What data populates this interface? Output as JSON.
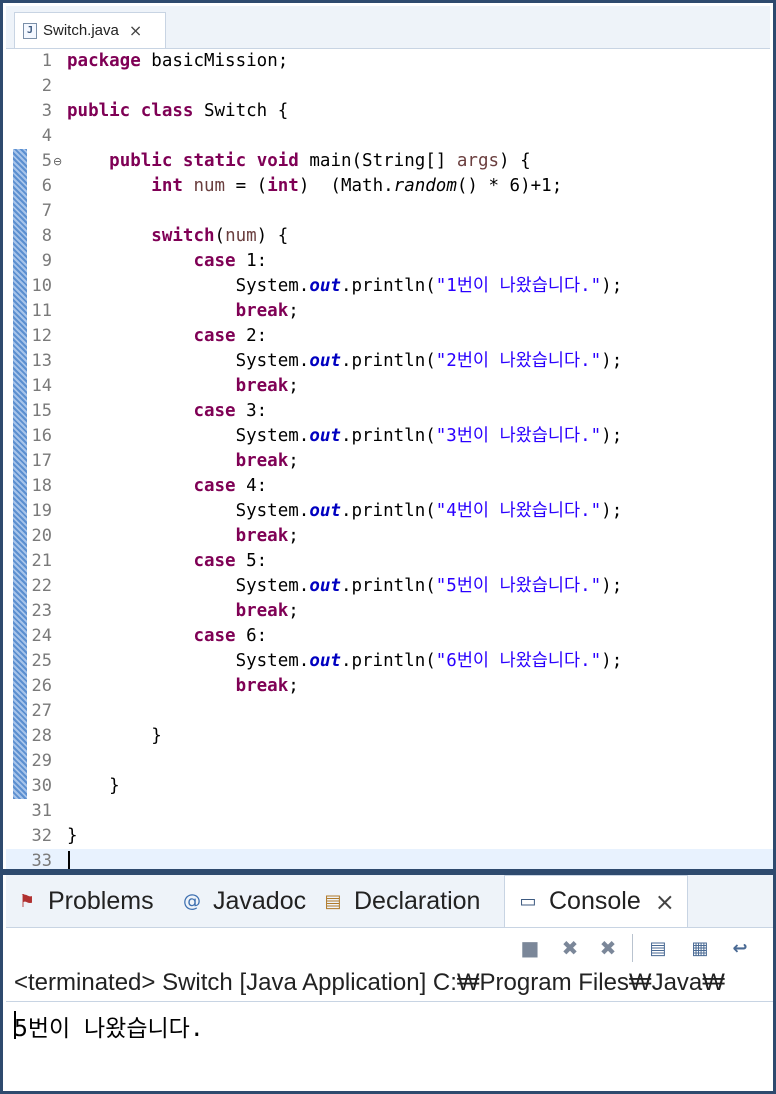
{
  "editor": {
    "tab_label": "Switch.java",
    "tab_icon": "java-file-icon",
    "close_glyph": "×"
  },
  "code_lines": [
    {
      "n": "1",
      "tokens": [
        {
          "t": "package",
          "c": "kw"
        },
        {
          "t": " basicMission;"
        }
      ]
    },
    {
      "n": "2",
      "tokens": []
    },
    {
      "n": "3",
      "tokens": [
        {
          "t": "public",
          "c": "kw"
        },
        {
          "t": " "
        },
        {
          "t": "class",
          "c": "kw"
        },
        {
          "t": " Switch {"
        }
      ]
    },
    {
      "n": "4",
      "tokens": []
    },
    {
      "n": "5",
      "fold": "⊖",
      "tokens": [
        {
          "t": "    "
        },
        {
          "t": "public",
          "c": "kw"
        },
        {
          "t": " "
        },
        {
          "t": "static",
          "c": "kw"
        },
        {
          "t": " "
        },
        {
          "t": "void",
          "c": "kw"
        },
        {
          "t": " main(String[] "
        },
        {
          "t": "args",
          "c": "arg"
        },
        {
          "t": ") {"
        }
      ]
    },
    {
      "n": "6",
      "tokens": [
        {
          "t": "        "
        },
        {
          "t": "int",
          "c": "kw"
        },
        {
          "t": " "
        },
        {
          "t": "num",
          "c": "arg"
        },
        {
          "t": " = ("
        },
        {
          "t": "int",
          "c": "kw"
        },
        {
          "t": ")  (Math."
        },
        {
          "t": "random",
          "c": "ital"
        },
        {
          "t": "() * 6)+1;"
        }
      ]
    },
    {
      "n": "7",
      "tokens": []
    },
    {
      "n": "8",
      "tokens": [
        {
          "t": "        "
        },
        {
          "t": "switch",
          "c": "kw"
        },
        {
          "t": "("
        },
        {
          "t": "num",
          "c": "arg"
        },
        {
          "t": ") {"
        }
      ]
    },
    {
      "n": "9",
      "tokens": [
        {
          "t": "            "
        },
        {
          "t": "case",
          "c": "kw"
        },
        {
          "t": " 1:"
        }
      ]
    },
    {
      "n": "10",
      "tokens": [
        {
          "t": "                System."
        },
        {
          "t": "out",
          "c": "fld"
        },
        {
          "t": ".println("
        },
        {
          "t": "\"1번이 나왔습니다.\"",
          "c": "str"
        },
        {
          "t": ");"
        }
      ]
    },
    {
      "n": "11",
      "tokens": [
        {
          "t": "                "
        },
        {
          "t": "break",
          "c": "kw"
        },
        {
          "t": ";"
        }
      ]
    },
    {
      "n": "12",
      "tokens": [
        {
          "t": "            "
        },
        {
          "t": "case",
          "c": "kw"
        },
        {
          "t": " 2:"
        }
      ]
    },
    {
      "n": "13",
      "tokens": [
        {
          "t": "                System."
        },
        {
          "t": "out",
          "c": "fld"
        },
        {
          "t": ".println("
        },
        {
          "t": "\"2번이 나왔습니다.\"",
          "c": "str"
        },
        {
          "t": ");"
        }
      ]
    },
    {
      "n": "14",
      "tokens": [
        {
          "t": "                "
        },
        {
          "t": "break",
          "c": "kw"
        },
        {
          "t": ";"
        }
      ]
    },
    {
      "n": "15",
      "tokens": [
        {
          "t": "            "
        },
        {
          "t": "case",
          "c": "kw"
        },
        {
          "t": " 3:"
        }
      ]
    },
    {
      "n": "16",
      "tokens": [
        {
          "t": "                System."
        },
        {
          "t": "out",
          "c": "fld"
        },
        {
          "t": ".println("
        },
        {
          "t": "\"3번이 나왔습니다.\"",
          "c": "str"
        },
        {
          "t": ");"
        }
      ]
    },
    {
      "n": "17",
      "tokens": [
        {
          "t": "                "
        },
        {
          "t": "break",
          "c": "kw"
        },
        {
          "t": ";"
        }
      ]
    },
    {
      "n": "18",
      "tokens": [
        {
          "t": "            "
        },
        {
          "t": "case",
          "c": "kw"
        },
        {
          "t": " 4:"
        }
      ]
    },
    {
      "n": "19",
      "tokens": [
        {
          "t": "                System."
        },
        {
          "t": "out",
          "c": "fld"
        },
        {
          "t": ".println("
        },
        {
          "t": "\"4번이 나왔습니다.\"",
          "c": "str"
        },
        {
          "t": ");"
        }
      ]
    },
    {
      "n": "20",
      "tokens": [
        {
          "t": "                "
        },
        {
          "t": "break",
          "c": "kw"
        },
        {
          "t": ";"
        }
      ]
    },
    {
      "n": "21",
      "tokens": [
        {
          "t": "            "
        },
        {
          "t": "case",
          "c": "kw"
        },
        {
          "t": " 5:"
        }
      ]
    },
    {
      "n": "22",
      "tokens": [
        {
          "t": "                System."
        },
        {
          "t": "out",
          "c": "fld"
        },
        {
          "t": ".println("
        },
        {
          "t": "\"5번이 나왔습니다.\"",
          "c": "str"
        },
        {
          "t": ");"
        }
      ]
    },
    {
      "n": "23",
      "tokens": [
        {
          "t": "                "
        },
        {
          "t": "break",
          "c": "kw"
        },
        {
          "t": ";"
        }
      ]
    },
    {
      "n": "24",
      "tokens": [
        {
          "t": "            "
        },
        {
          "t": "case",
          "c": "kw"
        },
        {
          "t": " 6:"
        }
      ]
    },
    {
      "n": "25",
      "tokens": [
        {
          "t": "                System."
        },
        {
          "t": "out",
          "c": "fld"
        },
        {
          "t": ".println("
        },
        {
          "t": "\"6번이 나왔습니다.\"",
          "c": "str"
        },
        {
          "t": ");"
        }
      ]
    },
    {
      "n": "26",
      "tokens": [
        {
          "t": "                "
        },
        {
          "t": "break",
          "c": "kw"
        },
        {
          "t": ";"
        }
      ]
    },
    {
      "n": "27",
      "tokens": []
    },
    {
      "n": "28",
      "tokens": [
        {
          "t": "        }"
        }
      ]
    },
    {
      "n": "29",
      "tokens": []
    },
    {
      "n": "30",
      "tokens": [
        {
          "t": "    }"
        }
      ]
    },
    {
      "n": "31",
      "tokens": []
    },
    {
      "n": "32",
      "tokens": [
        {
          "t": "}"
        }
      ]
    },
    {
      "n": "33",
      "current": true,
      "tokens": []
    }
  ],
  "panel": {
    "tabs": [
      {
        "label": "Problems",
        "icon": "problems-icon",
        "glyph": "⚑"
      },
      {
        "label": "Javadoc",
        "icon": "javadoc-icon",
        "glyph": "@"
      },
      {
        "label": "Declaration",
        "icon": "declaration-icon",
        "glyph": "▤"
      },
      {
        "label": "Console",
        "icon": "console-icon",
        "glyph": "▭",
        "active": true
      }
    ],
    "close_glyph": "×",
    "toolbar": [
      {
        "name": "terminate-icon",
        "glyph": "■"
      },
      {
        "name": "remove-launch-icon",
        "glyph": "✖"
      },
      {
        "name": "remove-all-terminated-icon",
        "glyph": "✖"
      },
      {
        "name": "clear-console-icon",
        "glyph": "▤"
      },
      {
        "name": "scroll-lock-icon",
        "glyph": "▦"
      },
      {
        "name": "word-wrap-icon",
        "glyph": "↩"
      }
    ],
    "status": "<terminated> Switch [Java Application] C:₩Program Files₩Java₩",
    "output": "5번이 나왔습니다."
  },
  "colors": {
    "keyword": "#7f0055",
    "field": "#0000c0",
    "string": "#2a00ff",
    "frame": "#2e4a6e"
  }
}
